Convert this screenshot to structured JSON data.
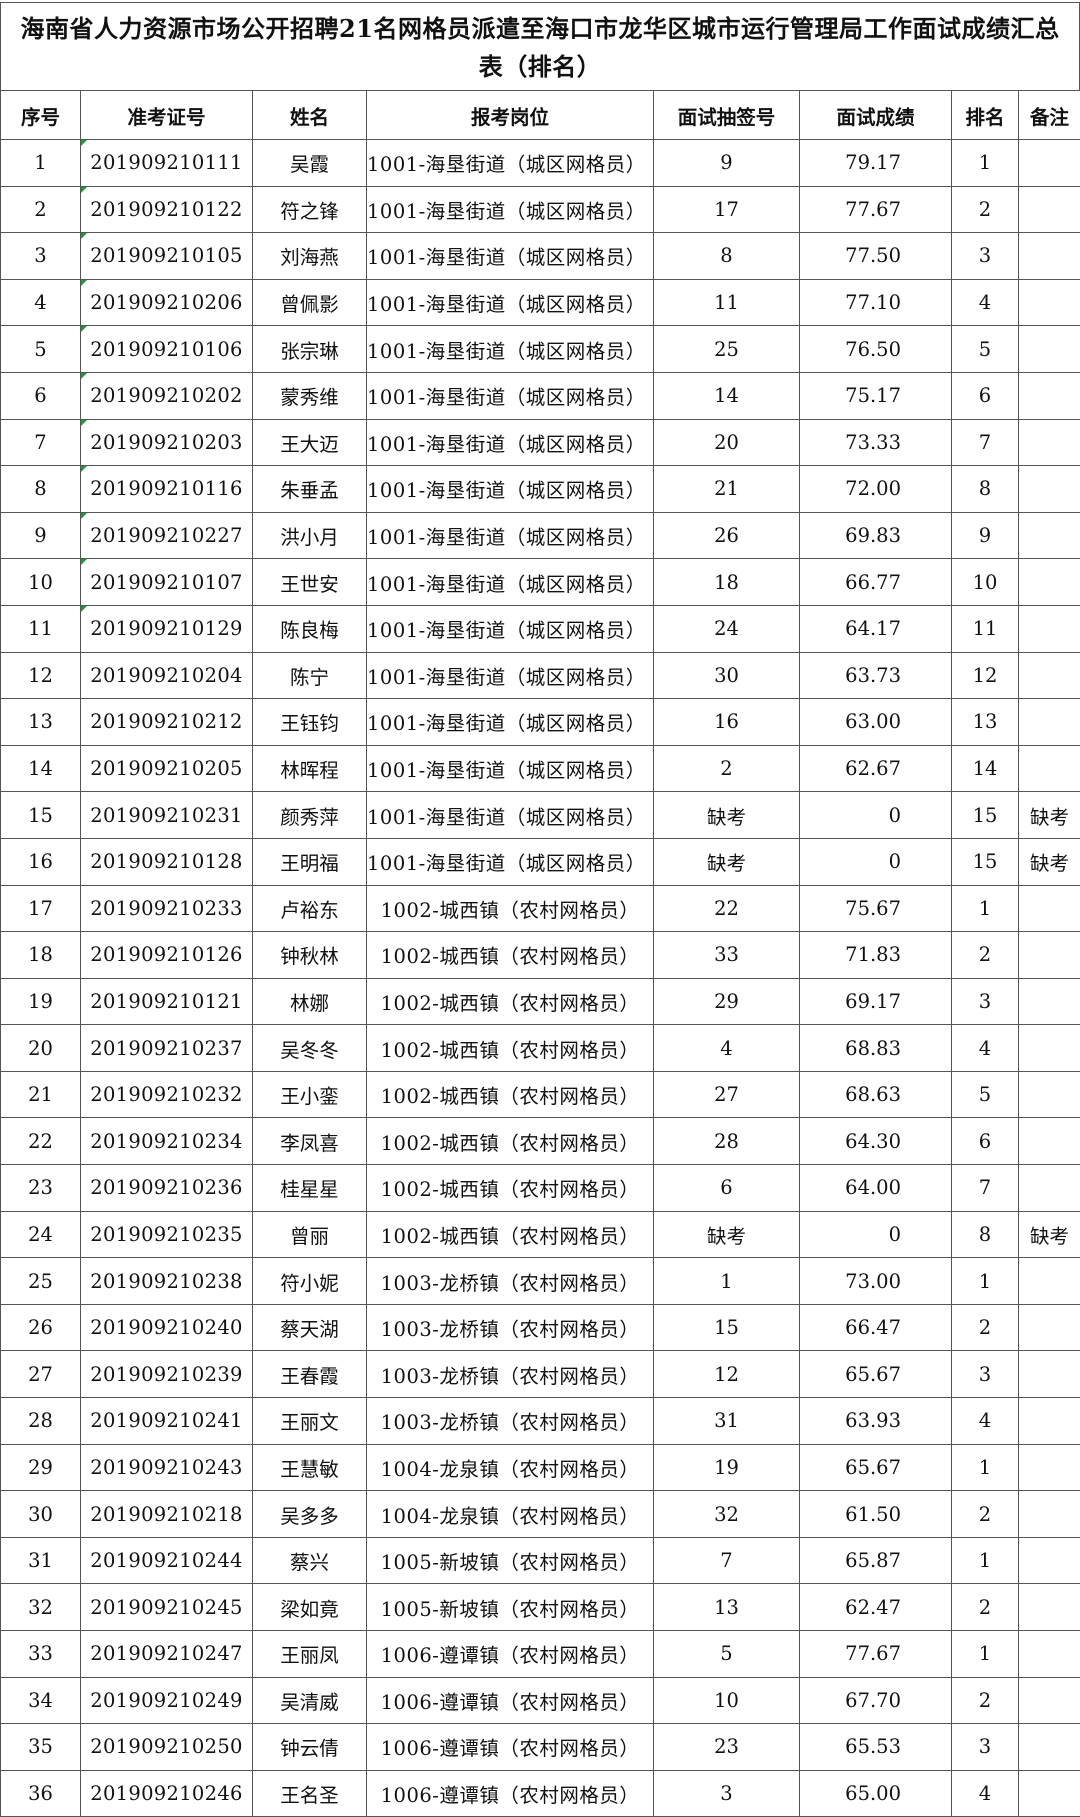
{
  "title": {
    "line1": "海南省人力资源市场公开招聘21名网格员派遣至海口市龙华区城市运行管理局工作面试成绩汇总",
    "line2": "表（排名）"
  },
  "headers": [
    "序号",
    "准考证号",
    "姓名",
    "报考岗位",
    "面试抽签号",
    "面试成绩",
    "排名",
    "备注"
  ],
  "rows": [
    {
      "no": "1",
      "id": "201909210111",
      "name": "吴霞",
      "post": "1001-海垦街道（城区网格员）",
      "draw": "9",
      "score": "79.17",
      "rank": "1",
      "note": "",
      "tick": true
    },
    {
      "no": "2",
      "id": "201909210122",
      "name": "符之锋",
      "post": "1001-海垦街道（城区网格员）",
      "draw": "17",
      "score": "77.67",
      "rank": "2",
      "note": "",
      "tick": true
    },
    {
      "no": "3",
      "id": "201909210105",
      "name": "刘海燕",
      "post": "1001-海垦街道（城区网格员）",
      "draw": "8",
      "score": "77.50",
      "rank": "3",
      "note": "",
      "tick": true
    },
    {
      "no": "4",
      "id": "201909210206",
      "name": "曾佩影",
      "post": "1001-海垦街道（城区网格员）",
      "draw": "11",
      "score": "77.10",
      "rank": "4",
      "note": "",
      "tick": true
    },
    {
      "no": "5",
      "id": "201909210106",
      "name": "张宗琳",
      "post": "1001-海垦街道（城区网格员）",
      "draw": "25",
      "score": "76.50",
      "rank": "5",
      "note": "",
      "tick": true
    },
    {
      "no": "6",
      "id": "201909210202",
      "name": "蒙秀维",
      "post": "1001-海垦街道（城区网格员）",
      "draw": "14",
      "score": "75.17",
      "rank": "6",
      "note": "",
      "tick": true
    },
    {
      "no": "7",
      "id": "201909210203",
      "name": "王大迈",
      "post": "1001-海垦街道（城区网格员）",
      "draw": "20",
      "score": "73.33",
      "rank": "7",
      "note": "",
      "tick": true
    },
    {
      "no": "8",
      "id": "201909210116",
      "name": "朱垂孟",
      "post": "1001-海垦街道（城区网格员）",
      "draw": "21",
      "score": "72.00",
      "rank": "8",
      "note": "",
      "tick": true
    },
    {
      "no": "9",
      "id": "201909210227",
      "name": "洪小月",
      "post": "1001-海垦街道（城区网格员）",
      "draw": "26",
      "score": "69.83",
      "rank": "9",
      "note": "",
      "tick": true
    },
    {
      "no": "10",
      "id": "201909210107",
      "name": "王世安",
      "post": "1001-海垦街道（城区网格员）",
      "draw": "18",
      "score": "66.77",
      "rank": "10",
      "note": "",
      "tick": true
    },
    {
      "no": "11",
      "id": "201909210129",
      "name": "陈良梅",
      "post": "1001-海垦街道（城区网格员）",
      "draw": "24",
      "score": "64.17",
      "rank": "11",
      "note": "",
      "tick": true
    },
    {
      "no": "12",
      "id": "201909210204",
      "name": "陈宁",
      "post": "1001-海垦街道（城区网格员）",
      "draw": "30",
      "score": "63.73",
      "rank": "12",
      "note": "",
      "tick": false
    },
    {
      "no": "13",
      "id": "201909210212",
      "name": "王钰钧",
      "post": "1001-海垦街道（城区网格员）",
      "draw": "16",
      "score": "63.00",
      "rank": "13",
      "note": "",
      "tick": false
    },
    {
      "no": "14",
      "id": "201909210205",
      "name": "林晖程",
      "post": "1001-海垦街道（城区网格员）",
      "draw": "2",
      "score": "62.67",
      "rank": "14",
      "note": "",
      "tick": false
    },
    {
      "no": "15",
      "id": "201909210231",
      "name": "颜秀萍",
      "post": "1001-海垦街道（城区网格员）",
      "draw": "缺考",
      "score": "0",
      "rank": "15",
      "note": "缺考",
      "tick": false
    },
    {
      "no": "16",
      "id": "201909210128",
      "name": "王明福",
      "post": "1001-海垦街道（城区网格员）",
      "draw": "缺考",
      "score": "0",
      "rank": "15",
      "note": "缺考",
      "tick": false
    },
    {
      "no": "17",
      "id": "201909210233",
      "name": "卢裕东",
      "post": "1002-城西镇（农村网格员）",
      "draw": "22",
      "score": "75.67",
      "rank": "1",
      "note": "",
      "tick": false
    },
    {
      "no": "18",
      "id": "201909210126",
      "name": "钟秋林",
      "post": "1002-城西镇（农村网格员）",
      "draw": "33",
      "score": "71.83",
      "rank": "2",
      "note": "",
      "tick": false
    },
    {
      "no": "19",
      "id": "201909210121",
      "name": "林娜",
      "post": "1002-城西镇（农村网格员）",
      "draw": "29",
      "score": "69.17",
      "rank": "3",
      "note": "",
      "tick": false
    },
    {
      "no": "20",
      "id": "201909210237",
      "name": "吴冬冬",
      "post": "1002-城西镇（农村网格员）",
      "draw": "4",
      "score": "68.83",
      "rank": "4",
      "note": "",
      "tick": false
    },
    {
      "no": "21",
      "id": "201909210232",
      "name": "王小銮",
      "post": "1002-城西镇（农村网格员）",
      "draw": "27",
      "score": "68.63",
      "rank": "5",
      "note": "",
      "tick": false
    },
    {
      "no": "22",
      "id": "201909210234",
      "name": "李凤喜",
      "post": "1002-城西镇（农村网格员）",
      "draw": "28",
      "score": "64.30",
      "rank": "6",
      "note": "",
      "tick": false
    },
    {
      "no": "23",
      "id": "201909210236",
      "name": "桂星星",
      "post": "1002-城西镇（农村网格员）",
      "draw": "6",
      "score": "64.00",
      "rank": "7",
      "note": "",
      "tick": false
    },
    {
      "no": "24",
      "id": "201909210235",
      "name": "曾丽",
      "post": "1002-城西镇（农村网格员）",
      "draw": "缺考",
      "score": "0",
      "rank": "8",
      "note": "缺考",
      "tick": false
    },
    {
      "no": "25",
      "id": "201909210238",
      "name": "符小妮",
      "post": "1003-龙桥镇（农村网格员）",
      "draw": "1",
      "score": "73.00",
      "rank": "1",
      "note": "",
      "tick": false
    },
    {
      "no": "26",
      "id": "201909210240",
      "name": "蔡天湖",
      "post": "1003-龙桥镇（农村网格员）",
      "draw": "15",
      "score": "66.47",
      "rank": "2",
      "note": "",
      "tick": false
    },
    {
      "no": "27",
      "id": "201909210239",
      "name": "王春霞",
      "post": "1003-龙桥镇（农村网格员）",
      "draw": "12",
      "score": "65.67",
      "rank": "3",
      "note": "",
      "tick": false
    },
    {
      "no": "28",
      "id": "201909210241",
      "name": "王丽文",
      "post": "1003-龙桥镇（农村网格员）",
      "draw": "31",
      "score": "63.93",
      "rank": "4",
      "note": "",
      "tick": false
    },
    {
      "no": "29",
      "id": "201909210243",
      "name": "王慧敏",
      "post": "1004-龙泉镇（农村网格员）",
      "draw": "19",
      "score": "65.67",
      "rank": "1",
      "note": "",
      "tick": false
    },
    {
      "no": "30",
      "id": "201909210218",
      "name": "吴多多",
      "post": "1004-龙泉镇（农村网格员）",
      "draw": "32",
      "score": "61.50",
      "rank": "2",
      "note": "",
      "tick": false
    },
    {
      "no": "31",
      "id": "201909210244",
      "name": "蔡兴",
      "post": "1005-新坡镇（农村网格员）",
      "draw": "7",
      "score": "65.87",
      "rank": "1",
      "note": "",
      "tick": false
    },
    {
      "no": "32",
      "id": "201909210245",
      "name": "梁如竟",
      "post": "1005-新坡镇（农村网格员）",
      "draw": "13",
      "score": "62.47",
      "rank": "2",
      "note": "",
      "tick": false
    },
    {
      "no": "33",
      "id": "201909210247",
      "name": "王丽凤",
      "post": "1006-遵谭镇（农村网格员）",
      "draw": "5",
      "score": "77.67",
      "rank": "1",
      "note": "",
      "tick": false
    },
    {
      "no": "34",
      "id": "201909210249",
      "name": "吴清威",
      "post": "1006-遵谭镇（农村网格员）",
      "draw": "10",
      "score": "67.70",
      "rank": "2",
      "note": "",
      "tick": false
    },
    {
      "no": "35",
      "id": "201909210250",
      "name": "钟云倩",
      "post": "1006-遵谭镇（农村网格员）",
      "draw": "23",
      "score": "65.53",
      "rank": "3",
      "note": "",
      "tick": false
    },
    {
      "no": "36",
      "id": "201909210246",
      "name": "王名圣",
      "post": "1006-遵谭镇（农村网格员）",
      "draw": "3",
      "score": "65.00",
      "rank": "4",
      "note": "",
      "tick": false
    }
  ],
  "colors": {
    "grid_line": "#555555",
    "tick_mark": "#1f9a3a",
    "text": "#111111"
  }
}
